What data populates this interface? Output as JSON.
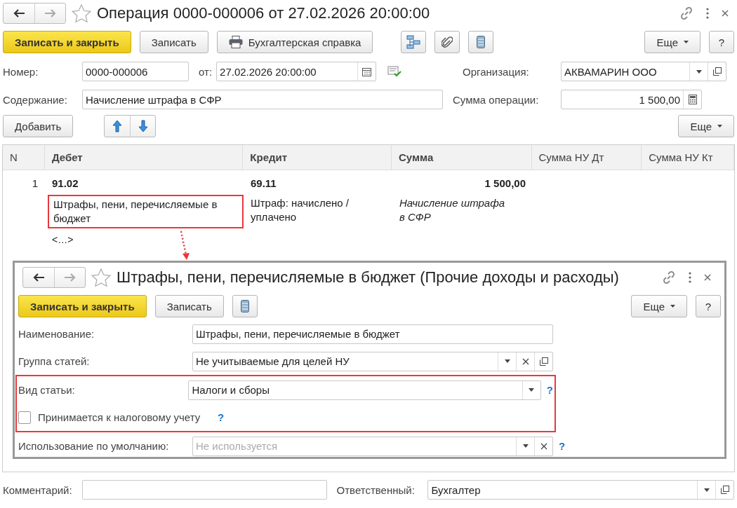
{
  "window": {
    "title": "Операция 0000-000006 от 27.02.2026 20:00:00"
  },
  "toolbar": {
    "buttons": [
      {
        "label": "Записать и закрыть",
        "kind": "primary"
      },
      {
        "label": "Записать",
        "kind": "plain"
      },
      {
        "label": "Бухгалтерская справка",
        "kind": "print"
      }
    ],
    "more": "Еще",
    "help": "?"
  },
  "header": {
    "number_label": "Номер:",
    "number": "0000-000006",
    "date_label": "от:",
    "date": "27.02.2026 20:00:00",
    "org_label": "Организация:",
    "org": "АКВАМАРИН ООО",
    "content_label": "Содержание:",
    "content": "Начисление штрафа в СФР",
    "sum_label": "Сумма операции:",
    "sum": "1 500,00"
  },
  "table_toolbar": {
    "add": "Добавить",
    "more": "Еще"
  },
  "table": {
    "columns": [
      "N",
      "Дебет",
      "Кредит",
      "Сумма",
      "Сумма НУ Дт",
      "Сумма НУ Кт"
    ],
    "rows": [
      {
        "n": "1",
        "debit": "91.02",
        "credit": "69.11",
        "sum": "1 500,00",
        "debit_subconto": "Штрафы, пени, перечисляемые в бюджет",
        "debit_subconto_highlighted": true,
        "credit_subconto": "Штраф: начислено / уплачено",
        "description": "Начисление штрафа в СФР",
        "debit_subconto_2": "<…>"
      }
    ]
  },
  "popup": {
    "title": "Штрафы, пени, перечисляемые в бюджет (Прочие доходы и расходы)",
    "buttons": [
      {
        "label": "Записать и закрыть",
        "kind": "primary"
      },
      {
        "label": "Записать",
        "kind": "plain"
      }
    ],
    "more": "Еще",
    "help": "?",
    "fields": [
      {
        "kind": "text",
        "label": "Наименование:",
        "value": "Штрафы, пени, перечисляемые в бюджет",
        "highlighted": false
      },
      {
        "kind": "select",
        "label": "Группа статей:",
        "value": "Не учитываемые для целей НУ",
        "clear": true,
        "open": true,
        "highlighted": false
      },
      {
        "kind": "select",
        "label": "Вид статьи:",
        "value": "Налоги и сборы",
        "clear": false,
        "open": false,
        "help": "?",
        "highlighted": true
      },
      {
        "kind": "checkbox",
        "label": "Принимается к налоговому учету",
        "checked": false,
        "help": "?",
        "highlighted": true
      },
      {
        "kind": "select",
        "label": "Использование по умолчанию:",
        "placeholder": "Не используется",
        "clear": true,
        "open": false,
        "help": "?",
        "highlighted": false
      }
    ]
  },
  "footer": {
    "comment_label": "Комментарий:",
    "responsible_label": "Ответственный:",
    "responsible": "Бухгалтер"
  }
}
